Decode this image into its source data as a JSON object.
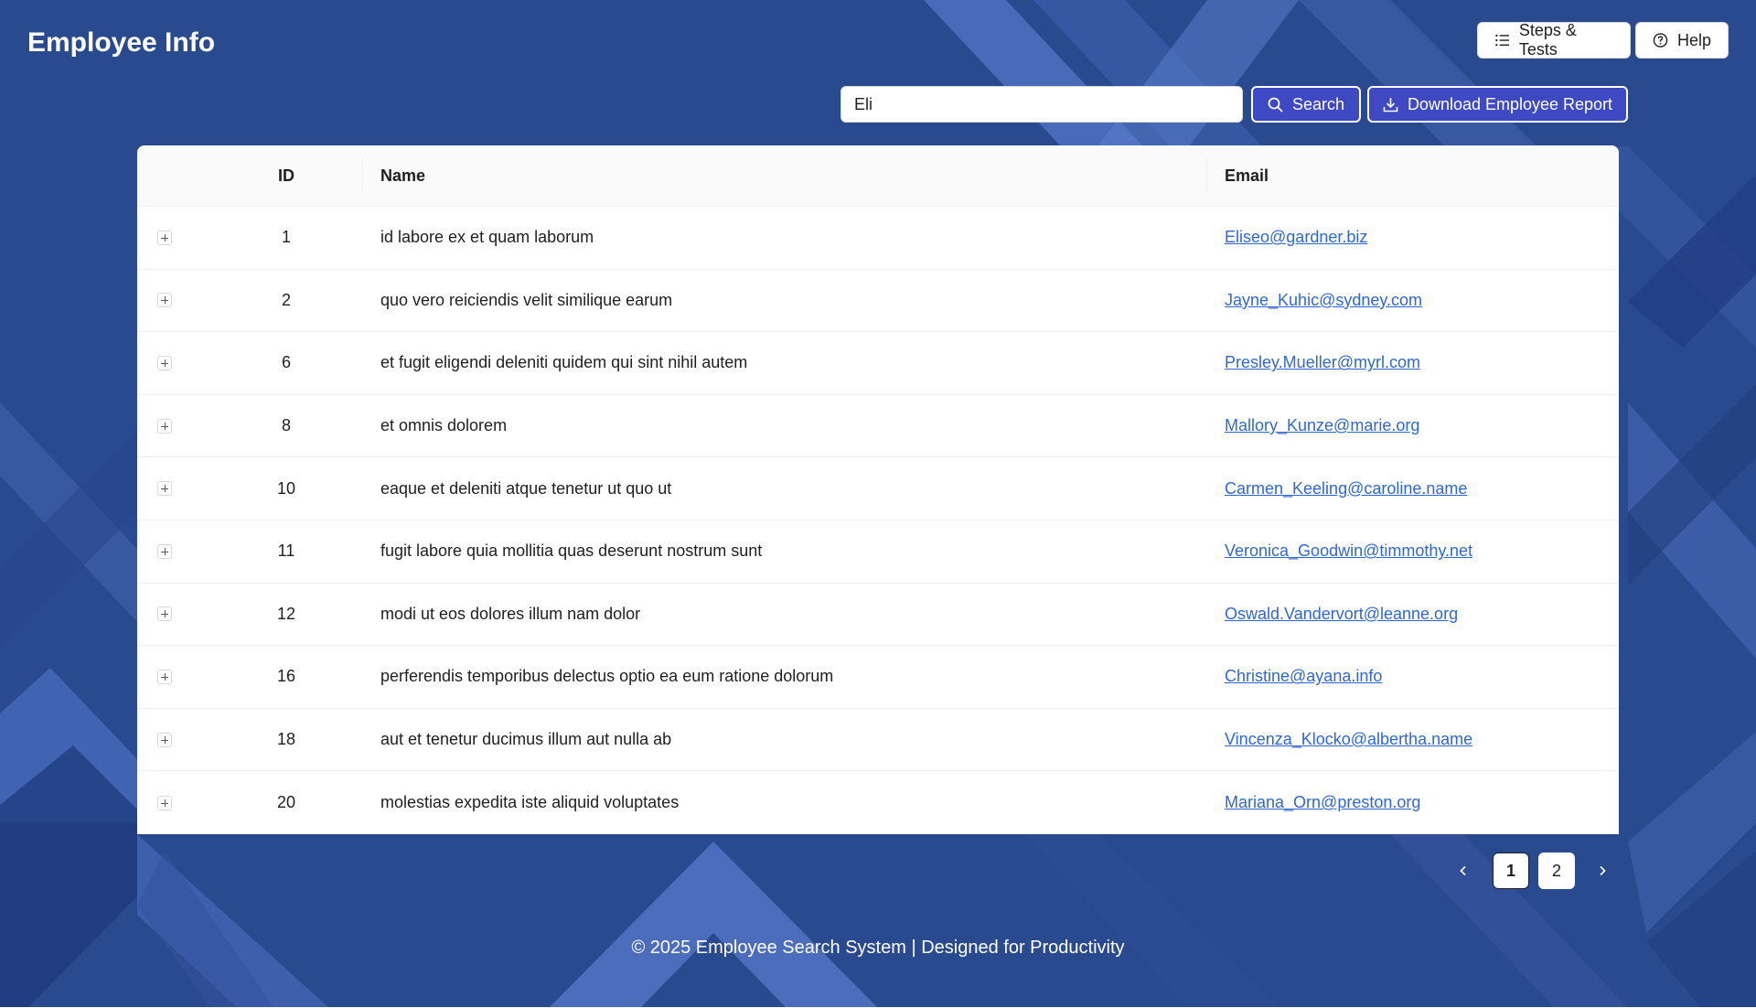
{
  "header": {
    "title": "Employee Info",
    "steps_label": "Steps & Tests",
    "help_label": "Help"
  },
  "search": {
    "value": "Eli",
    "button_label": "Search",
    "download_label": "Download Employee Report"
  },
  "table": {
    "columns": {
      "id": "ID",
      "name": "Name",
      "email": "Email"
    },
    "rows": [
      {
        "id": "1",
        "name": "id labore ex et quam laborum",
        "email": "Eliseo@gardner.biz"
      },
      {
        "id": "2",
        "name": "quo vero reiciendis velit similique earum",
        "email": "Jayne_Kuhic@sydney.com"
      },
      {
        "id": "6",
        "name": "et fugit eligendi deleniti quidem qui sint nihil autem",
        "email": "Presley.Mueller@myrl.com"
      },
      {
        "id": "8",
        "name": "et omnis dolorem",
        "email": "Mallory_Kunze@marie.org"
      },
      {
        "id": "10",
        "name": "eaque et deleniti atque tenetur ut quo ut",
        "email": "Carmen_Keeling@caroline.name"
      },
      {
        "id": "11",
        "name": "fugit labore quia mollitia quas deserunt nostrum sunt",
        "email": "Veronica_Goodwin@timmothy.net"
      },
      {
        "id": "12",
        "name": "modi ut eos dolores illum nam dolor",
        "email": "Oswald.Vandervort@leanne.org"
      },
      {
        "id": "16",
        "name": "perferendis temporibus delectus optio ea eum ratione dolorum",
        "email": "Christine@ayana.info"
      },
      {
        "id": "18",
        "name": "aut et tenetur ducimus illum aut nulla ab",
        "email": "Vincenza_Klocko@albertha.name"
      },
      {
        "id": "20",
        "name": "molestias expedita iste aliquid voluptates",
        "email": "Mariana_Orn@preston.org"
      }
    ]
  },
  "pagination": {
    "pages": [
      "1",
      "2"
    ],
    "current": "1"
  },
  "footer": {
    "text": "© 2025 Employee Search System | Designed for Productivity"
  },
  "colors": {
    "background": "#2b4a8e",
    "accent": "#3f49c3",
    "link": "#2f67d8"
  }
}
